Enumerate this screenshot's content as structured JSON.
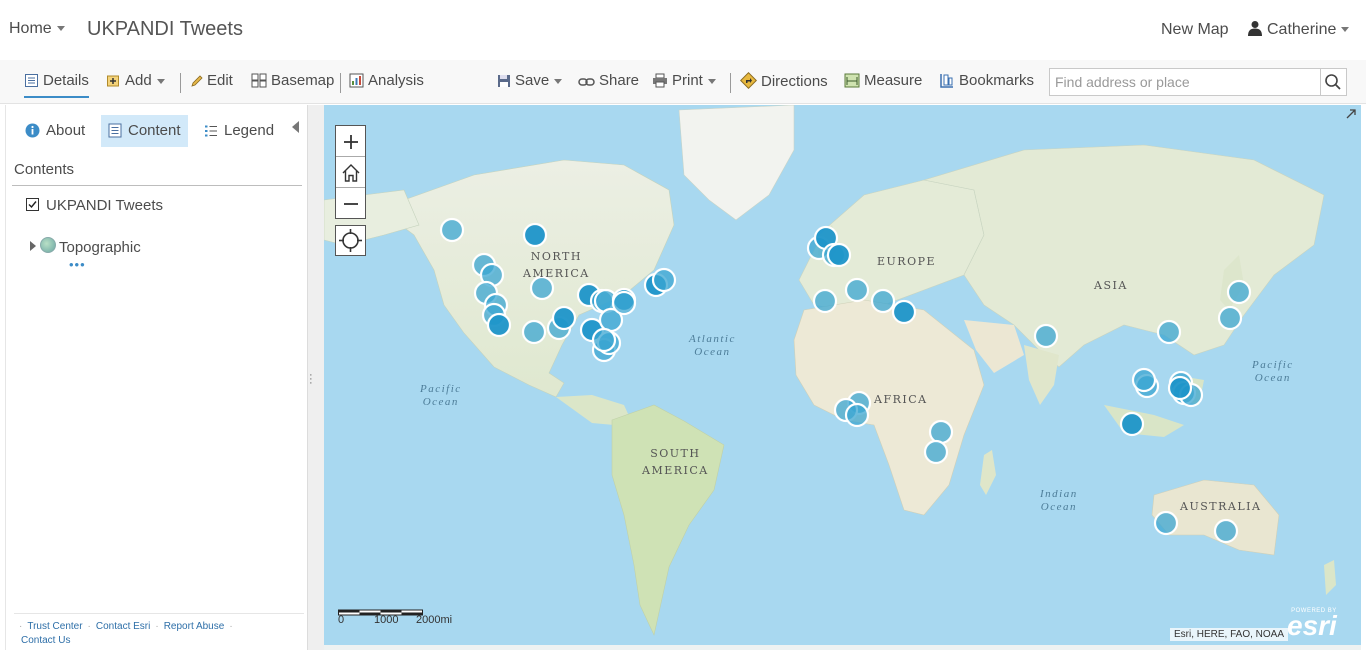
{
  "header": {
    "home_label": "Home",
    "map_title": "UKPANDI Tweets",
    "new_map_label": "New Map",
    "user_name": "Catherine"
  },
  "toolbar": {
    "details": "Details",
    "add": "Add",
    "edit": "Edit",
    "basemap": "Basemap",
    "analysis": "Analysis",
    "save": "Save",
    "share": "Share",
    "print": "Print",
    "directions": "Directions",
    "measure": "Measure",
    "bookmarks": "Bookmarks",
    "search_placeholder": "Find address or place"
  },
  "panel": {
    "tabs": {
      "about": "About",
      "content": "Content",
      "legend": "Legend"
    },
    "contents_heading": "Contents",
    "layer_name": "UKPANDI Tweets",
    "basemap_name": "Topographic",
    "footer": {
      "trust_center": "Trust Center",
      "contact_esri": "Contact Esri",
      "report_abuse": "Report Abuse",
      "contact_us": "Contact Us"
    }
  },
  "map": {
    "labels": {
      "north_america_1": "NORTH",
      "north_america_2": "AMERICA",
      "south_america_1": "SOUTH",
      "south_america_2": "AMERICA",
      "europe": "EUROPE",
      "asia": "ASIA",
      "africa": "AFRICA",
      "australia": "AUSTRALIA",
      "atlantic_1": "Atlantic",
      "atlantic_2": "Ocean",
      "pacific_w_1": "Pacific",
      "pacific_w_2": "Ocean",
      "pacific_e_1": "Pacific",
      "pacific_e_2": "Ocean",
      "indian_1": "Indian",
      "indian_2": "Ocean"
    },
    "scale": {
      "s0": "0",
      "s1": "1000",
      "s2": "2000mi"
    },
    "attribution": "Esri, HERE, FAO, NOAA",
    "powered_by": "POWERED BY",
    "esri_logo": "esri",
    "marker_color": "#3ba6d1",
    "marker_color_dark": "#1e95c9",
    "water_color": "#a8d8f0"
  }
}
